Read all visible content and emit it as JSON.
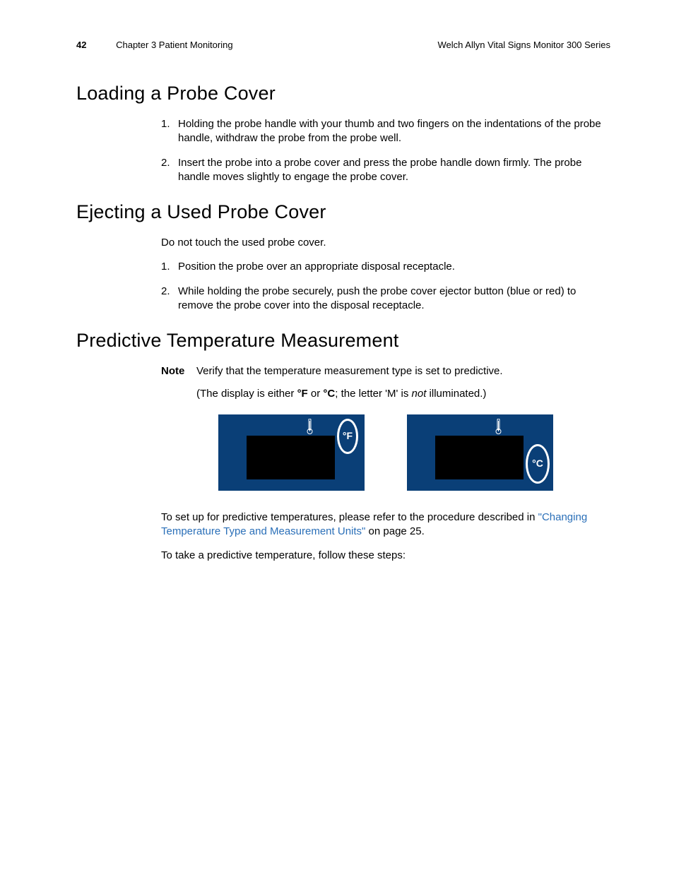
{
  "header": {
    "page_number": "42",
    "chapter": "Chapter 3   Patient Monitoring",
    "doc_title": "Welch Allyn Vital Signs Monitor 300 Series"
  },
  "section1": {
    "heading": "Loading a Probe Cover",
    "steps": [
      "Holding the probe handle with your thumb and two fingers on the indentations of the probe handle, withdraw the probe from the probe well.",
      "Insert the probe into a probe cover and press the probe handle down firmly. The probe handle moves slightly to engage the probe cover."
    ]
  },
  "section2": {
    "heading": "Ejecting a Used Probe Cover",
    "intro": "Do not touch the used probe cover.",
    "steps": [
      "Position the probe over an appropriate disposal receptacle.",
      "While holding the probe securely, push the probe cover ejector button (blue or red) to remove the probe cover into the disposal receptacle."
    ]
  },
  "section3": {
    "heading": "Predictive Temperature Measurement",
    "note_label": "Note",
    "note_text": "Verify that the temperature measurement type is set to predictive.",
    "note_sub_a": "(The display is either ",
    "unit_f": "°F",
    "note_sub_b": " or ",
    "unit_c": "°C",
    "note_sub_c": "; the letter 'M' is ",
    "not_word": "not",
    "note_sub_d": " illuminated.)",
    "display_f_label": "°F",
    "display_c_label": "°C",
    "para1_a": "To set up for predictive temperatures, please refer to the procedure described in ",
    "link_text": "\"Changing Temperature Type and Measurement Units\"",
    "para1_b": " on page 25.",
    "para2": "To take a predictive temperature, follow these steps:"
  }
}
